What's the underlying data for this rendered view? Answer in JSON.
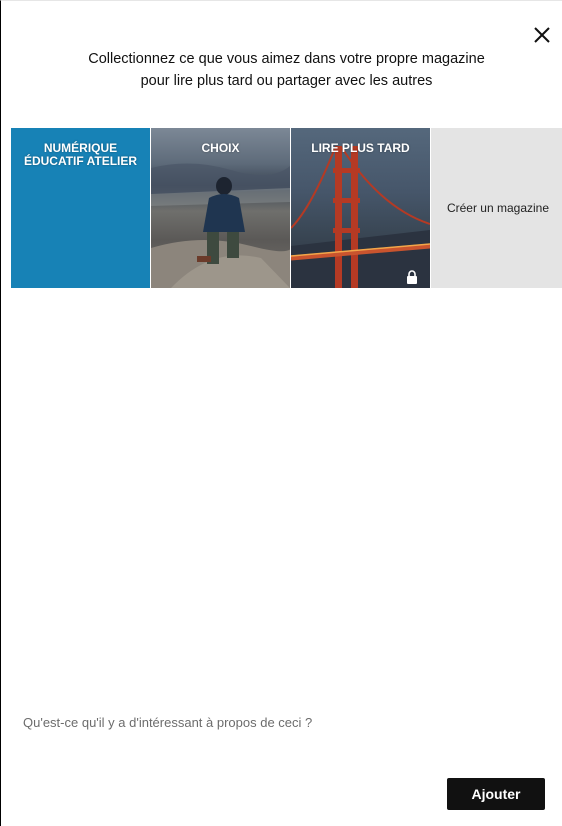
{
  "dialog": {
    "intro_line1": "Collectionnez ce que vous aimez dans votre propre magazine",
    "intro_line2": "pour lire plus tard ou partager avec les autres",
    "close_icon": "close-icon"
  },
  "magazines": [
    {
      "title": "NUMÉRIQUE ÉDUCATIF ATELIER",
      "color": "#1782b6"
    },
    {
      "title": "CHOIX"
    },
    {
      "title": "LIRE PLUS TARD",
      "locked": true,
      "lock_icon": "lock-icon"
    },
    {
      "title": "Créer un magazine",
      "color": "#e4e4e4"
    }
  ],
  "comment": {
    "placeholder": "Qu'est-ce qu'il y a d'intéressant à propos de ceci ?"
  },
  "actions": {
    "add_label": "Ajouter",
    "add_color": "#111111"
  }
}
